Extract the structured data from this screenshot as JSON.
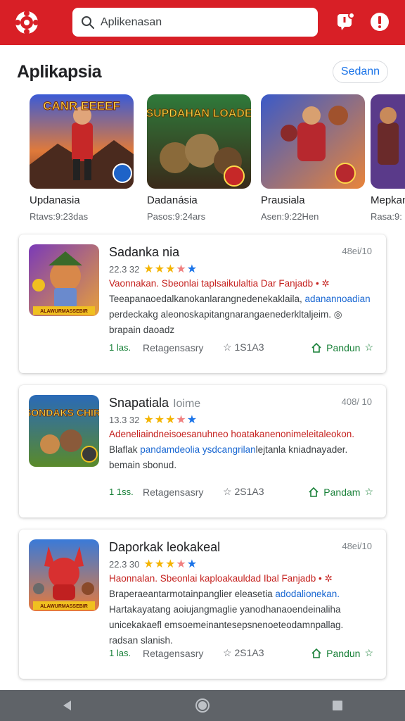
{
  "header": {
    "search_value": "Aplikenasan",
    "colors": {
      "bar": "#d81f26",
      "accent": "#1a73e8",
      "download": "#188038"
    },
    "icons": [
      "app-logo-icon",
      "search-icon",
      "notification-icon",
      "alert-icon"
    ]
  },
  "section": {
    "title": "Aplikapsia",
    "see_all_label": "Sedann"
  },
  "featured": [
    {
      "name": "Updanasia",
      "sub": "Rtavs:9:23das",
      "art_text": "CANR EEEEF"
    },
    {
      "name": "Dadanásia",
      "sub": "Pasos:9:24ars",
      "art_text": "SUPDAHAN LOADE"
    },
    {
      "name": "Prausiala",
      "sub": "Asen:9:22Hen",
      "art_text": ""
    },
    {
      "name": "Mepkan",
      "sub": "Rasa:9:",
      "art_text": ""
    }
  ],
  "apps": [
    {
      "title": "Sadanka nia",
      "title_sub": "",
      "size": "48ei/10",
      "rating": "22.3 32",
      "stars": [
        "★",
        "★",
        "★",
        "★",
        "★"
      ],
      "desc1": "Vaonnakan. Sbeonlai taplsaikulaltia Dar Fanjadb • ✲",
      "desc2_a": "Teeapanaoedalkanokanlarangnedenekaklaila, ",
      "desc2_b": "adanannoadian",
      "desc3": "perdeckakg aleonoskapitangnarangaenederkltaljeim. ◎",
      "desc4": "brapain daoadz",
      "downloads": "1 las.",
      "category": "Retagensasry",
      "reviews": "☆ 1S1A3",
      "action": "Pandun",
      "thumb_text": "ALAWURMASSEBIR"
    },
    {
      "title": "Snapatiala",
      "title_sub": "Ioime",
      "size": "408/ 10",
      "rating": "13.3 32",
      "stars": [
        "★",
        "★",
        "★",
        "★",
        "★"
      ],
      "desc1": "Adeneliaindneisoesanuhneo hoatakanenonimeleitaleokon.",
      "desc2_a": "Blaflak ",
      "desc2_b": "pandamdeolia ysdcangrilan",
      "desc3": "bemain sbonud.",
      "desc4": "",
      "desc2_c": "lejtanla kniadnayader.",
      "downloads": "1 1ss.",
      "category": "Retagensasry",
      "reviews": "☆ 2S1A3",
      "action": "Pandam",
      "thumb_text": "SONDAKS CHIR"
    },
    {
      "title": "Daporkak leokakeal",
      "title_sub": "",
      "size": "48ei/10",
      "rating": "22.3 30",
      "stars": [
        "★",
        "★",
        "★",
        "★",
        "★"
      ],
      "desc1": "Haonnalan. Sbeonlai kaploakauldad Ibal Fanjadb • ✲",
      "desc2_a": "Braperaeantarmotainpanglier eleasetia ",
      "desc2_b": "adodalionekan.",
      "desc3": "Hartakayatang aoiujangmaglie yanodhanaoendeinaliha",
      "desc4": "unicekakaefl emsoemeinantesepsnenoeteodamnpallag.",
      "desc5": "radsan slanish.",
      "downloads": "1 las.",
      "category": "Retagensasry",
      "reviews": "☆ 2S1A3",
      "action": "Pandun",
      "thumb_text": "ALAWURMASSEBIR"
    }
  ]
}
